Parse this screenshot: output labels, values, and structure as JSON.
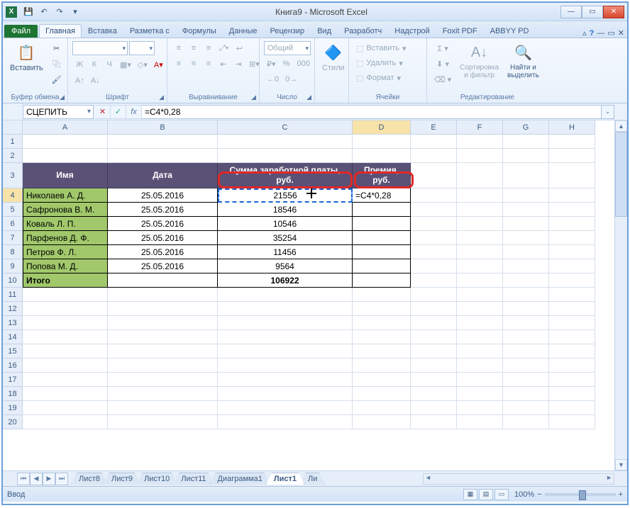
{
  "window": {
    "title": "Книга9 - Microsoft Excel"
  },
  "qat": {
    "save": "💾",
    "undo": "↶",
    "redo": "↷"
  },
  "tabs": {
    "file": "Файл",
    "list": [
      "Главная",
      "Вставка",
      "Разметка с",
      "Формулы",
      "Данные",
      "Рецензир",
      "Вид",
      "Разработч",
      "Надстрой",
      "Foxit PDF",
      "ABBYY PD"
    ],
    "active": 0
  },
  "ribbon": {
    "clipboard": {
      "paste": "Вставить",
      "group": "Буфер обмена"
    },
    "font": {
      "group": "Шрифт",
      "bold": "Ж",
      "italic": "К",
      "underline": "Ч"
    },
    "align": {
      "group": "Выравнивание"
    },
    "number": {
      "format": "Общий",
      "group": "Число"
    },
    "styles": {
      "btn": "Стили"
    },
    "cells": {
      "insert": "Вставить",
      "delete": "Удалить",
      "format": "Формат",
      "group": "Ячейки"
    },
    "editing": {
      "sort": "Сортировка\nи фильтр",
      "find": "Найти и\nвыделить",
      "group": "Редактирование"
    }
  },
  "namebox": "СЦЕПИТЬ",
  "formula": "=C4*0,28",
  "columns": [
    "A",
    "B",
    "C",
    "D",
    "E",
    "F",
    "G",
    "H"
  ],
  "headers": {
    "name": "Имя",
    "date": "Дата",
    "salary": "Сумма заработной платы,\nруб.",
    "bonus": "Премия,\nруб."
  },
  "data": [
    {
      "name": "Николаев А. Д.",
      "date": "25.05.2016",
      "salary": "21556",
      "bonus": "=C4*0,28"
    },
    {
      "name": "Сафронова В. М.",
      "date": "25.05.2016",
      "salary": "18546",
      "bonus": ""
    },
    {
      "name": "Коваль Л. П.",
      "date": "25.05.2016",
      "salary": "10546",
      "bonus": ""
    },
    {
      "name": "Парфенов Д. Ф.",
      "date": "25.05.2016",
      "salary": "35254",
      "bonus": ""
    },
    {
      "name": "Петров Ф. Л.",
      "date": "25.05.2016",
      "salary": "11456",
      "bonus": ""
    },
    {
      "name": "Попова М. Д.",
      "date": "25.05.2016",
      "salary": "9564",
      "bonus": ""
    }
  ],
  "total": {
    "label": "Итого",
    "salary": "106922"
  },
  "sheets": {
    "list": [
      "Лист8",
      "Лист9",
      "Лист10",
      "Лист11",
      "Диаграмма1",
      "Лист1",
      "Ли"
    ],
    "active": 5
  },
  "status": {
    "mode": "Ввод",
    "zoom": "100%"
  }
}
